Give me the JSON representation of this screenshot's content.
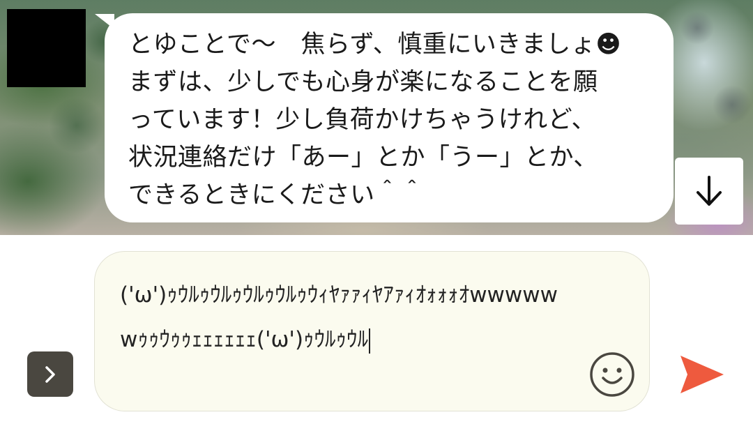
{
  "chat": {
    "message_lines": [
      "とゆことで〜　焦らず、慎重にいきましょ☻",
      "まずは、少しでも心身が楽になることを願",
      "っています！少し負荷かけちゃうけれど、",
      "状況連絡だけ「あー」とか「うー」とか、",
      "できるときにください＾＾"
    ],
    "scroll_down_icon": "arrow-down-icon"
  },
  "composer": {
    "input_value": "('ω')ｩｳﾙｩｳﾙｩｳﾙｩｳﾙｩｳｨﾔｧｧｨﾔｱｧｨｵｫｫｫｵwwwwwwｩｩｳｩｩｪｪｪｪｪｪ('ω')ｩｳﾙｩｳﾙ",
    "expand_icon": "chevron-right-icon",
    "emoji_icon": "smiley-icon",
    "send_icon": "send-icon"
  },
  "colors": {
    "send_accent": "#ee5a3e",
    "expand_button_bg": "#4a4740",
    "input_bg": "#fbfbef"
  }
}
